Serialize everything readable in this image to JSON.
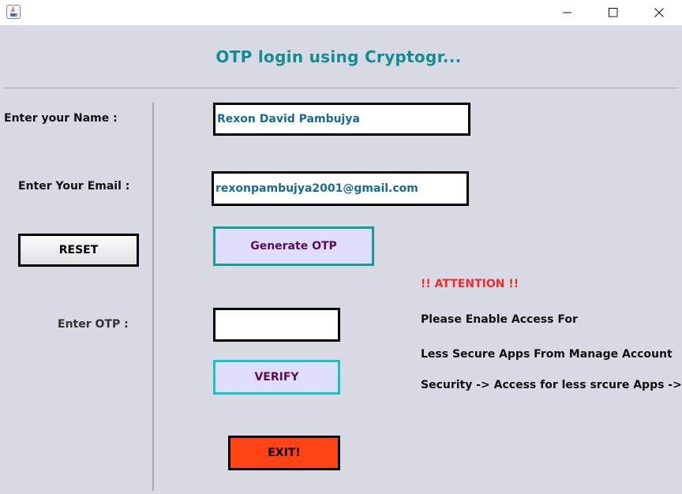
{
  "window": {
    "icon": "java-coffee-icon",
    "controls": [
      "minimize-icon",
      "maximize-icon",
      "close-icon"
    ]
  },
  "header": {
    "title": "OTP login using Cryptogr..."
  },
  "form": {
    "name_label": "Enter your Name :",
    "name_value": "Rexon David Pambujya",
    "email_label": "Enter Your Email :",
    "email_value": "rexonpambujya2001@gmail.com",
    "otp_label": "Enter OTP :",
    "otp_value": ""
  },
  "buttons": {
    "reset": "RESET",
    "generate_otp": "Generate OTP",
    "verify": "VERIFY",
    "exit": "EXIT!"
  },
  "notice": {
    "attention": "!! ATTENTION !!",
    "line1": "Please Enable Access For",
    "line2": "Less Secure Apps From Manage Account",
    "line3": "Security -> Access for less srcure Apps -> ON"
  },
  "colors": {
    "title": "#138d93",
    "attention": "#ee2b2b",
    "exit_button": "#ff4314",
    "generate_border": "#159a9e",
    "verify_border": "#14c5cc",
    "field_text": "#156b96"
  }
}
